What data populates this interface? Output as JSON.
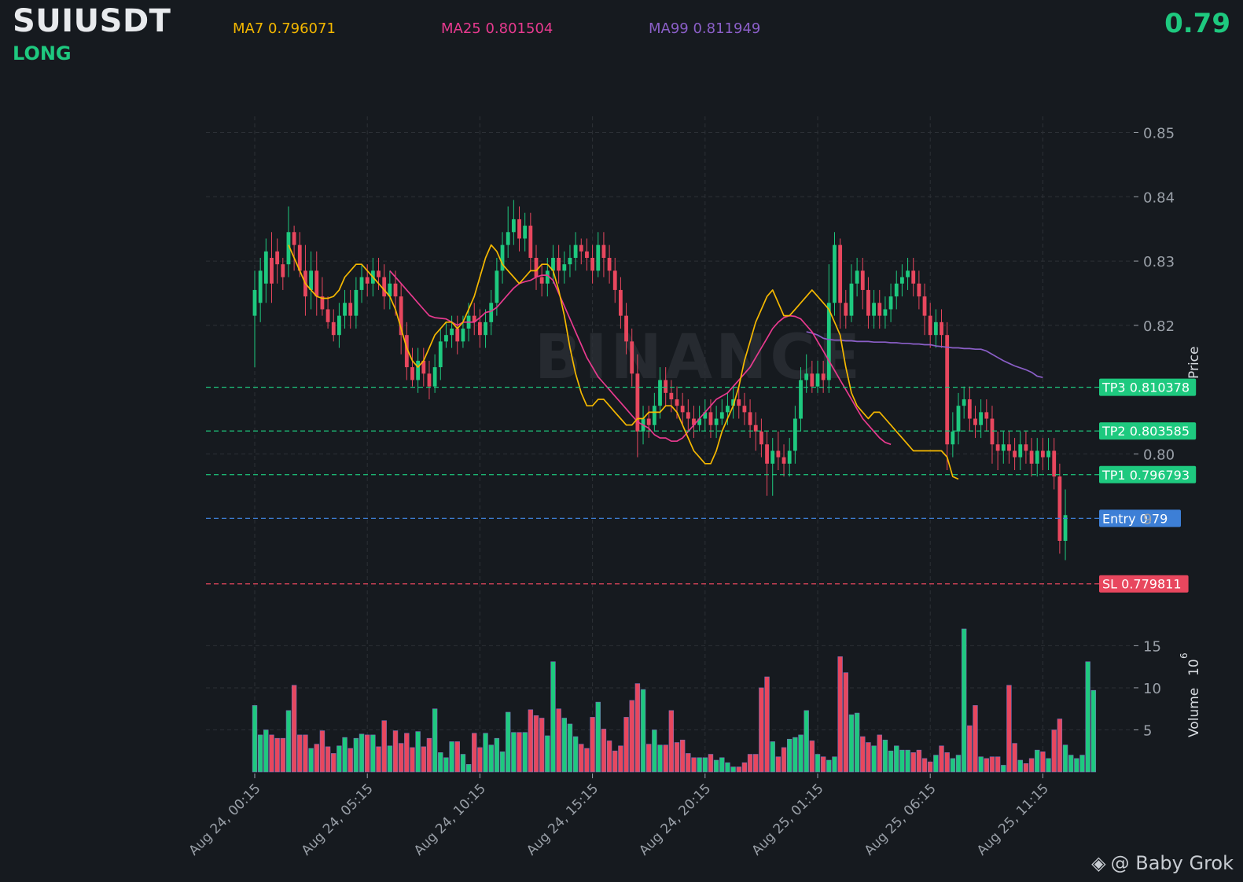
{
  "header": {
    "symbol": "SUIUSDT",
    "direction": "LONG",
    "last_price": "0.79",
    "ma7_label": "MA7 0.796071",
    "ma25_label": "MA25 0.801504",
    "ma99_label": "MA99 0.811949"
  },
  "watermark": "BINANCE",
  "credit": {
    "icon": "binance-logo-icon",
    "text": "@ Baby Grok"
  },
  "colors": {
    "background": "#161a1f",
    "up": "#1ec97f",
    "down": "#e8475e",
    "ma7": "#f5b800",
    "ma25": "#e83a8f",
    "ma99": "#8b5fc8",
    "entry": "#3d7fd6",
    "grid": "#2c3036",
    "axis_text": "#9aa0a8"
  },
  "chart_data": {
    "type": "candlestick",
    "price_axis": {
      "label": "Price",
      "ticks": [
        0.8,
        0.82,
        0.83,
        0.84,
        0.85
      ],
      "tick_labels": [
        "0.80",
        "0.82",
        "0.83",
        "0.84",
        "0.85"
      ],
      "partial_tick_label": "9",
      "range": [
        0.7755,
        0.8525
      ]
    },
    "volume_axis": {
      "label": "Volume",
      "exponent_label": "10",
      "exponent_power": "6",
      "ticks": [
        5,
        10,
        15
      ],
      "tick_labels": [
        "5",
        "10",
        "15"
      ],
      "range": [
        0,
        17
      ]
    },
    "x_ticks": [
      {
        "index": 0,
        "label": "Aug 24, 00:15"
      },
      {
        "index": 20,
        "label": "Aug 24, 05:15"
      },
      {
        "index": 40,
        "label": "Aug 24, 10:15"
      },
      {
        "index": 60,
        "label": "Aug 24, 15:15"
      },
      {
        "index": 80,
        "label": "Aug 24, 20:15"
      },
      {
        "index": 100,
        "label": "Aug 25, 01:15"
      },
      {
        "index": 120,
        "label": "Aug 25, 06:15"
      },
      {
        "index": 140,
        "label": "Aug 25, 11:15"
      }
    ],
    "levels": [
      {
        "name": "TP3",
        "label": "TP3 0.810378",
        "value": 0.810378,
        "color": "#1ec97f"
      },
      {
        "name": "TP2",
        "label": "TP2 0.803585",
        "value": 0.803585,
        "color": "#1ec97f"
      },
      {
        "name": "TP1",
        "label": "TP1 0.796793",
        "value": 0.796793,
        "color": "#1ec97f"
      },
      {
        "name": "Entry",
        "label": "Entry 0.79",
        "value": 0.79,
        "color": "#3d7fd6"
      },
      {
        "name": "SL",
        "label": "SL 0.779811",
        "value": 0.779811,
        "color": "#e8475e"
      }
    ],
    "candles": [
      [
        0.8215,
        0.8255,
        0.8135,
        0.8285
      ],
      [
        0.8235,
        0.8285,
        0.8205,
        0.8305
      ],
      [
        0.8265,
        0.8315,
        0.8235,
        0.8335
      ],
      [
        0.8305,
        0.8265,
        0.8235,
        0.8345
      ],
      [
        0.8315,
        0.8295,
        0.8265,
        0.8335
      ],
      [
        0.8295,
        0.8275,
        0.8255,
        0.8305
      ],
      [
        0.8295,
        0.8345,
        0.8275,
        0.8385
      ],
      [
        0.8345,
        0.8325,
        0.8285,
        0.8355
      ],
      [
        0.8325,
        0.8285,
        0.8275,
        0.8345
      ],
      [
        0.8285,
        0.8245,
        0.8215,
        0.8325
      ],
      [
        0.8255,
        0.8285,
        0.8225,
        0.8315
      ],
      [
        0.8285,
        0.8245,
        0.8215,
        0.8315
      ],
      [
        0.8245,
        0.8225,
        0.8215,
        0.8275
      ],
      [
        0.8225,
        0.8205,
        0.8195,
        0.8245
      ],
      [
        0.8205,
        0.8185,
        0.8175,
        0.8225
      ],
      [
        0.8185,
        0.8215,
        0.8165,
        0.8235
      ],
      [
        0.8215,
        0.8235,
        0.8195,
        0.8255
      ],
      [
        0.8235,
        0.8215,
        0.8195,
        0.8255
      ],
      [
        0.8215,
        0.8255,
        0.8195,
        0.8275
      ],
      [
        0.8255,
        0.8275,
        0.8235,
        0.8295
      ],
      [
        0.8275,
        0.8265,
        0.8245,
        0.8295
      ],
      [
        0.8265,
        0.8285,
        0.8245,
        0.8305
      ],
      [
        0.8285,
        0.8275,
        0.8255,
        0.8305
      ],
      [
        0.8275,
        0.8245,
        0.8225,
        0.8295
      ],
      [
        0.8245,
        0.8265,
        0.8225,
        0.8285
      ],
      [
        0.8265,
        0.8245,
        0.8215,
        0.8285
      ],
      [
        0.8245,
        0.8185,
        0.8155,
        0.8265
      ],
      [
        0.8185,
        0.8135,
        0.8115,
        0.8205
      ],
      [
        0.8135,
        0.8115,
        0.8105,
        0.8165
      ],
      [
        0.8115,
        0.8145,
        0.8095,
        0.8165
      ],
      [
        0.8145,
        0.8125,
        0.8105,
        0.8165
      ],
      [
        0.8125,
        0.8105,
        0.8085,
        0.8145
      ],
      [
        0.8105,
        0.8135,
        0.8095,
        0.8155
      ],
      [
        0.8135,
        0.8175,
        0.8115,
        0.8195
      ],
      [
        0.8175,
        0.8185,
        0.8165,
        0.8205
      ],
      [
        0.8185,
        0.8195,
        0.8165,
        0.8215
      ],
      [
        0.8195,
        0.8175,
        0.8155,
        0.8215
      ],
      [
        0.8175,
        0.8195,
        0.8165,
        0.8215
      ],
      [
        0.8195,
        0.8215,
        0.8175,
        0.8235
      ],
      [
        0.8215,
        0.8205,
        0.8185,
        0.8235
      ],
      [
        0.8205,
        0.8185,
        0.8165,
        0.8225
      ],
      [
        0.8185,
        0.8205,
        0.8165,
        0.8225
      ],
      [
        0.8205,
        0.8235,
        0.8185,
        0.8255
      ],
      [
        0.8235,
        0.8285,
        0.8215,
        0.8305
      ],
      [
        0.8285,
        0.8325,
        0.8265,
        0.8345
      ],
      [
        0.8325,
        0.8345,
        0.8305,
        0.8385
      ],
      [
        0.8345,
        0.8365,
        0.8325,
        0.8395
      ],
      [
        0.8365,
        0.8335,
        0.8315,
        0.8385
      ],
      [
        0.8335,
        0.8355,
        0.8315,
        0.8375
      ],
      [
        0.8355,
        0.8305,
        0.8285,
        0.8375
      ],
      [
        0.8305,
        0.8275,
        0.8255,
        0.8325
      ],
      [
        0.8275,
        0.8265,
        0.8245,
        0.8295
      ],
      [
        0.8265,
        0.8285,
        0.8245,
        0.8305
      ],
      [
        0.8285,
        0.8305,
        0.8265,
        0.8325
      ],
      [
        0.8305,
        0.8285,
        0.8265,
        0.8325
      ],
      [
        0.8285,
        0.8295,
        0.8265,
        0.8315
      ],
      [
        0.8295,
        0.8305,
        0.8275,
        0.8325
      ],
      [
        0.8305,
        0.8325,
        0.8285,
        0.8345
      ],
      [
        0.8325,
        0.8315,
        0.8295,
        0.8335
      ],
      [
        0.8315,
        0.8305,
        0.8285,
        0.8335
      ],
      [
        0.8305,
        0.8285,
        0.8265,
        0.8325
      ],
      [
        0.8285,
        0.8325,
        0.8275,
        0.8345
      ],
      [
        0.8325,
        0.8305,
        0.8275,
        0.8345
      ],
      [
        0.8305,
        0.8285,
        0.8265,
        0.8325
      ],
      [
        0.8285,
        0.8255,
        0.8235,
        0.8305
      ],
      [
        0.8255,
        0.8215,
        0.8195,
        0.8275
      ],
      [
        0.8215,
        0.8175,
        0.8155,
        0.8235
      ],
      [
        0.8175,
        0.8125,
        0.8105,
        0.8195
      ],
      [
        0.8125,
        0.8035,
        0.7995,
        0.8155
      ],
      [
        0.8035,
        0.8055,
        0.8015,
        0.8075
      ],
      [
        0.8055,
        0.8045,
        0.8025,
        0.8075
      ],
      [
        0.8045,
        0.8075,
        0.8035,
        0.8095
      ],
      [
        0.8075,
        0.8115,
        0.8055,
        0.8135
      ],
      [
        0.8115,
        0.8095,
        0.8075,
        0.8135
      ],
      [
        0.8095,
        0.8085,
        0.8065,
        0.8115
      ],
      [
        0.8085,
        0.8075,
        0.8055,
        0.8105
      ],
      [
        0.8075,
        0.8065,
        0.8045,
        0.8095
      ],
      [
        0.8065,
        0.8055,
        0.8035,
        0.8085
      ],
      [
        0.8055,
        0.8045,
        0.8025,
        0.8075
      ],
      [
        0.8045,
        0.8055,
        0.8035,
        0.8075
      ],
      [
        0.8055,
        0.8065,
        0.8035,
        0.8085
      ],
      [
        0.8065,
        0.8045,
        0.8025,
        0.8085
      ],
      [
        0.8045,
        0.8055,
        0.8025,
        0.8075
      ],
      [
        0.8055,
        0.8065,
        0.8045,
        0.8085
      ],
      [
        0.8065,
        0.8075,
        0.8045,
        0.8095
      ],
      [
        0.8075,
        0.8085,
        0.8055,
        0.8105
      ],
      [
        0.8085,
        0.8075,
        0.8055,
        0.8105
      ],
      [
        0.8075,
        0.8065,
        0.8045,
        0.8095
      ],
      [
        0.8065,
        0.8045,
        0.8025,
        0.8085
      ],
      [
        0.8045,
        0.8035,
        0.8005,
        0.8065
      ],
      [
        0.8035,
        0.8015,
        0.7995,
        0.8055
      ],
      [
        0.8015,
        0.7985,
        0.7935,
        0.8035
      ],
      [
        0.7985,
        0.8005,
        0.7935,
        0.8025
      ],
      [
        0.8005,
        0.7995,
        0.7975,
        0.8035
      ],
      [
        0.7995,
        0.7985,
        0.7965,
        0.8015
      ],
      [
        0.7985,
        0.8005,
        0.7965,
        0.8025
      ],
      [
        0.8005,
        0.8055,
        0.7985,
        0.8075
      ],
      [
        0.8055,
        0.8115,
        0.8035,
        0.8135
      ],
      [
        0.8115,
        0.8125,
        0.8095,
        0.8155
      ],
      [
        0.8125,
        0.8105,
        0.8095,
        0.8145
      ],
      [
        0.8105,
        0.8125,
        0.8095,
        0.8145
      ],
      [
        0.8125,
        0.8115,
        0.8095,
        0.8145
      ],
      [
        0.8115,
        0.8235,
        0.8095,
        0.8295
      ],
      [
        0.8235,
        0.8325,
        0.8215,
        0.8345
      ],
      [
        0.8325,
        0.8235,
        0.8195,
        0.8335
      ],
      [
        0.8235,
        0.8215,
        0.8195,
        0.8255
      ],
      [
        0.8215,
        0.8265,
        0.8205,
        0.8295
      ],
      [
        0.8265,
        0.8285,
        0.8245,
        0.8305
      ],
      [
        0.8285,
        0.8255,
        0.8225,
        0.8305
      ],
      [
        0.8255,
        0.8215,
        0.8195,
        0.8275
      ],
      [
        0.8215,
        0.8235,
        0.8195,
        0.8255
      ],
      [
        0.8235,
        0.8215,
        0.8195,
        0.8255
      ],
      [
        0.8215,
        0.8225,
        0.8195,
        0.8245
      ],
      [
        0.8225,
        0.8245,
        0.8205,
        0.8265
      ],
      [
        0.8245,
        0.8265,
        0.8225,
        0.8285
      ],
      [
        0.8265,
        0.8275,
        0.8245,
        0.8295
      ],
      [
        0.8275,
        0.8285,
        0.8255,
        0.8305
      ],
      [
        0.8285,
        0.8265,
        0.8245,
        0.8305
      ],
      [
        0.8265,
        0.8245,
        0.8225,
        0.8285
      ],
      [
        0.8245,
        0.8215,
        0.8185,
        0.8265
      ],
      [
        0.8215,
        0.8185,
        0.8165,
        0.8235
      ],
      [
        0.8185,
        0.8205,
        0.8165,
        0.8225
      ],
      [
        0.8205,
        0.8185,
        0.8165,
        0.8225
      ],
      [
        0.8185,
        0.8015,
        0.7975,
        0.8205
      ],
      [
        0.8015,
        0.8035,
        0.7995,
        0.8065
      ],
      [
        0.8035,
        0.8075,
        0.8015,
        0.8095
      ],
      [
        0.8075,
        0.8085,
        0.8055,
        0.8105
      ],
      [
        0.8085,
        0.8055,
        0.8035,
        0.8105
      ],
      [
        0.8055,
        0.8045,
        0.8025,
        0.8075
      ],
      [
        0.8045,
        0.8065,
        0.8025,
        0.8085
      ],
      [
        0.8065,
        0.8055,
        0.8035,
        0.8085
      ],
      [
        0.8055,
        0.8015,
        0.7985,
        0.8075
      ],
      [
        0.8015,
        0.8005,
        0.7975,
        0.8035
      ],
      [
        0.8005,
        0.8015,
        0.7985,
        0.8035
      ],
      [
        0.8015,
        0.8005,
        0.7985,
        0.8035
      ],
      [
        0.8005,
        0.7995,
        0.7975,
        0.8025
      ],
      [
        0.7995,
        0.8015,
        0.7975,
        0.8035
      ],
      [
        0.8015,
        0.8005,
        0.7985,
        0.8035
      ],
      [
        0.8005,
        0.7985,
        0.7965,
        0.8025
      ],
      [
        0.7985,
        0.8005,
        0.7965,
        0.8025
      ],
      [
        0.8005,
        0.7995,
        0.7975,
        0.8025
      ],
      [
        0.7995,
        0.8005,
        0.7975,
        0.8025
      ],
      [
        0.8005,
        0.7965,
        0.7945,
        0.8025
      ],
      [
        0.7965,
        0.7865,
        0.7845,
        0.7985
      ],
      [
        0.7865,
        0.7905,
        0.7835,
        0.7945
      ]
    ],
    "volumes": [
      7.9,
      4.4,
      5.0,
      4.4,
      4.0,
      4.0,
      7.3,
      10.3,
      4.4,
      4.4,
      2.8,
      3.3,
      4.9,
      3.0,
      2.2,
      3.1,
      4.1,
      2.8,
      4.0,
      4.5,
      4.4,
      4.4,
      3.0,
      6.1,
      3.1,
      4.9,
      3.4,
      4.6,
      2.9,
      4.8,
      3.0,
      4.0,
      7.5,
      2.3,
      1.7,
      3.6,
      3.6,
      2.1,
      0.9,
      4.6,
      2.9,
      4.6,
      3.2,
      4.0,
      2.4,
      7.1,
      4.7,
      4.7,
      4.7,
      7.4,
      6.7,
      6.4,
      4.3,
      13.1,
      7.5,
      6.4,
      5.7,
      4.2,
      3.3,
      2.8,
      6.5,
      8.3,
      5.1,
      3.7,
      2.5,
      3.1,
      6.5,
      8.5,
      10.5,
      9.8,
      3.3,
      5.0,
      3.2,
      3.2,
      7.3,
      3.5,
      3.8,
      2.2,
      1.7,
      1.7,
      1.7,
      2.1,
      1.4,
      1.7,
      1.1,
      0.6,
      0.6,
      1.1,
      2.1,
      2.1,
      10.0,
      11.3,
      3.6,
      1.8,
      2.9,
      3.9,
      4.1,
      4.4,
      7.3,
      3.7,
      2.1,
      1.8,
      1.4,
      1.8,
      13.7,
      11.8,
      6.8,
      7.0,
      4.2,
      3.5,
      3.1,
      4.4,
      3.8,
      2.5,
      3.1,
      2.6,
      2.6,
      2.3,
      2.6,
      1.6,
      1.2,
      2.0,
      3.1,
      2.3,
      1.6,
      2.0,
      17.0,
      5.5,
      7.9,
      1.8,
      1.6,
      1.8,
      1.8,
      0.8,
      10.3,
      3.4,
      1.4,
      1.0,
      1.6,
      2.6,
      2.4,
      1.6,
      5.0,
      6.3,
      3.2,
      2.0,
      1.6,
      2.0,
      13.1,
      9.7
    ],
    "ma7": {
      "start_index": 6,
      "values": [
        0.8325,
        0.8305,
        0.8285,
        0.8265,
        0.8255,
        0.8245,
        0.8242,
        0.8242,
        0.8245,
        0.8255,
        0.8275,
        0.8285,
        0.8295,
        0.8295,
        0.8285,
        0.8275,
        0.8265,
        0.8255,
        0.8245,
        0.8225,
        0.8195,
        0.8165,
        0.8145,
        0.8135,
        0.8145,
        0.8165,
        0.8185,
        0.8195,
        0.8205,
        0.8205,
        0.8195,
        0.8205,
        0.8225,
        0.8245,
        0.8275,
        0.8305,
        0.8325,
        0.8315,
        0.8295,
        0.8285,
        0.8275,
        0.8265,
        0.8275,
        0.8285,
        0.8285,
        0.8295,
        0.8295,
        0.8285,
        0.8255,
        0.8215,
        0.8165,
        0.8125,
        0.8095,
        0.8075,
        0.8075,
        0.8085,
        0.8085,
        0.8075,
        0.8065,
        0.8055,
        0.8045,
        0.8045,
        0.8055,
        0.8055,
        0.8065,
        0.8065,
        0.8065,
        0.8075,
        0.8075,
        0.8065,
        0.8045,
        0.8025,
        0.8005,
        0.7995,
        0.7985,
        0.7985,
        0.8005,
        0.8035,
        0.8055,
        0.8075,
        0.8105,
        0.8145,
        0.8175,
        0.8205,
        0.8225,
        0.8245,
        0.8255,
        0.8235,
        0.8215,
        0.8215,
        0.8225,
        0.8235,
        0.8245,
        0.8255,
        0.8245,
        0.8235,
        0.8225,
        0.8205,
        0.8185,
        0.8135,
        0.8095,
        0.8075,
        0.8065,
        0.8055,
        0.8065,
        0.8065,
        0.8055,
        0.8045,
        0.8035,
        0.8025,
        0.8015,
        0.8005,
        0.8005,
        0.8005,
        0.8005,
        0.8005,
        0.8005,
        0.7995,
        0.7965,
        0.7961
      ]
    },
    "ma25": {
      "start_index": 24,
      "values": [
        0.8285,
        0.8275,
        0.8265,
        0.8255,
        0.8245,
        0.8235,
        0.8225,
        0.8215,
        0.8212,
        0.8211,
        0.821,
        0.8205,
        0.82,
        0.8205,
        0.8205,
        0.8205,
        0.8212,
        0.822,
        0.8222,
        0.8228,
        0.8238,
        0.8248,
        0.8258,
        0.8265,
        0.8268,
        0.827,
        0.8275,
        0.8278,
        0.8278,
        0.827,
        0.825,
        0.823,
        0.821,
        0.819,
        0.817,
        0.815,
        0.8135,
        0.812,
        0.811,
        0.81,
        0.809,
        0.808,
        0.807,
        0.806,
        0.805,
        0.8045,
        0.804,
        0.803,
        0.8025,
        0.8025,
        0.802,
        0.802,
        0.8025,
        0.8035,
        0.8045,
        0.8055,
        0.8065,
        0.8075,
        0.8085,
        0.809,
        0.8095,
        0.8105,
        0.8115,
        0.8125,
        0.8135,
        0.815,
        0.8165,
        0.818,
        0.8195,
        0.8205,
        0.8212,
        0.8215,
        0.8214,
        0.821,
        0.82,
        0.819,
        0.8175,
        0.816,
        0.8145,
        0.813,
        0.8115,
        0.81,
        0.8085,
        0.807,
        0.8055,
        0.8045,
        0.8035,
        0.8025,
        0.8018,
        0.8015
      ]
    },
    "ma99": {
      "start_index": 98,
      "values": [
        0.819,
        0.8188,
        0.8185,
        0.818,
        0.8178,
        0.8177,
        0.8177,
        0.8176,
        0.8176,
        0.8175,
        0.8175,
        0.8175,
        0.8174,
        0.8174,
        0.8174,
        0.8173,
        0.8173,
        0.8172,
        0.8172,
        0.8171,
        0.8171,
        0.817,
        0.817,
        0.8168,
        0.8167,
        0.8166,
        0.8165,
        0.8165,
        0.8164,
        0.8164,
        0.8163,
        0.8163,
        0.816,
        0.8155,
        0.815,
        0.8145,
        0.8141,
        0.8137,
        0.8134,
        0.8131,
        0.8127,
        0.8121,
        0.8119
      ]
    }
  }
}
